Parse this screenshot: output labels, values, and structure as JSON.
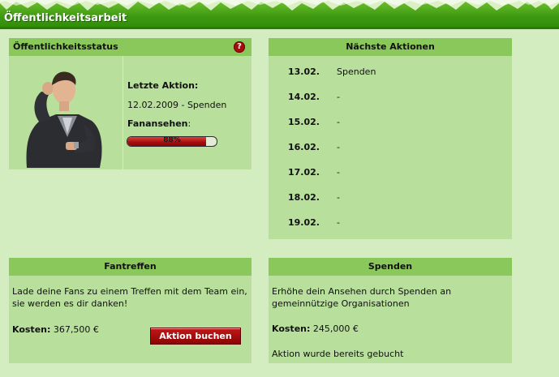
{
  "title": "Öffentlichkeitsarbeit",
  "status": {
    "heading": "Öffentlichkeitsstatus",
    "help_icon": "?",
    "last_action_label": "Letzte Aktion:",
    "last_action_value": "12.02.2009 - Spenden",
    "reputation_label": "Fanansehen",
    "reputation_colon": ":",
    "reputation_percent": 88,
    "reputation_text": "88%"
  },
  "next_actions": {
    "heading": "Nächste Aktionen",
    "rows": [
      {
        "date": "13.02.",
        "action": "Spenden"
      },
      {
        "date": "14.02.",
        "action": "-"
      },
      {
        "date": "15.02.",
        "action": "-"
      },
      {
        "date": "16.02.",
        "action": "-"
      },
      {
        "date": "17.02.",
        "action": "-"
      },
      {
        "date": "18.02.",
        "action": "-"
      },
      {
        "date": "19.02.",
        "action": "-"
      }
    ]
  },
  "fantreffen": {
    "heading": "Fantreffen",
    "description": "Lade deine Fans zu einem Treffen mit dem Team ein, sie werden es dir danken!",
    "cost_label": "Kosten:",
    "cost_value": "367,500 €",
    "button_label": "Aktion buchen"
  },
  "spenden": {
    "heading": "Spenden",
    "description": "Erhöhe dein Ansehen durch Spenden an gemeinnützige Organisationen",
    "cost_label": "Kosten:",
    "cost_value": "245,000 €",
    "status_text": "Aktion wurde bereits gebucht"
  },
  "colors": {
    "header_green": "#3f9a12",
    "box_bg": "#b8df9c",
    "box_head": "#8ac85c",
    "page_bg": "#d4edc0",
    "button_red": "#a40d0d"
  }
}
